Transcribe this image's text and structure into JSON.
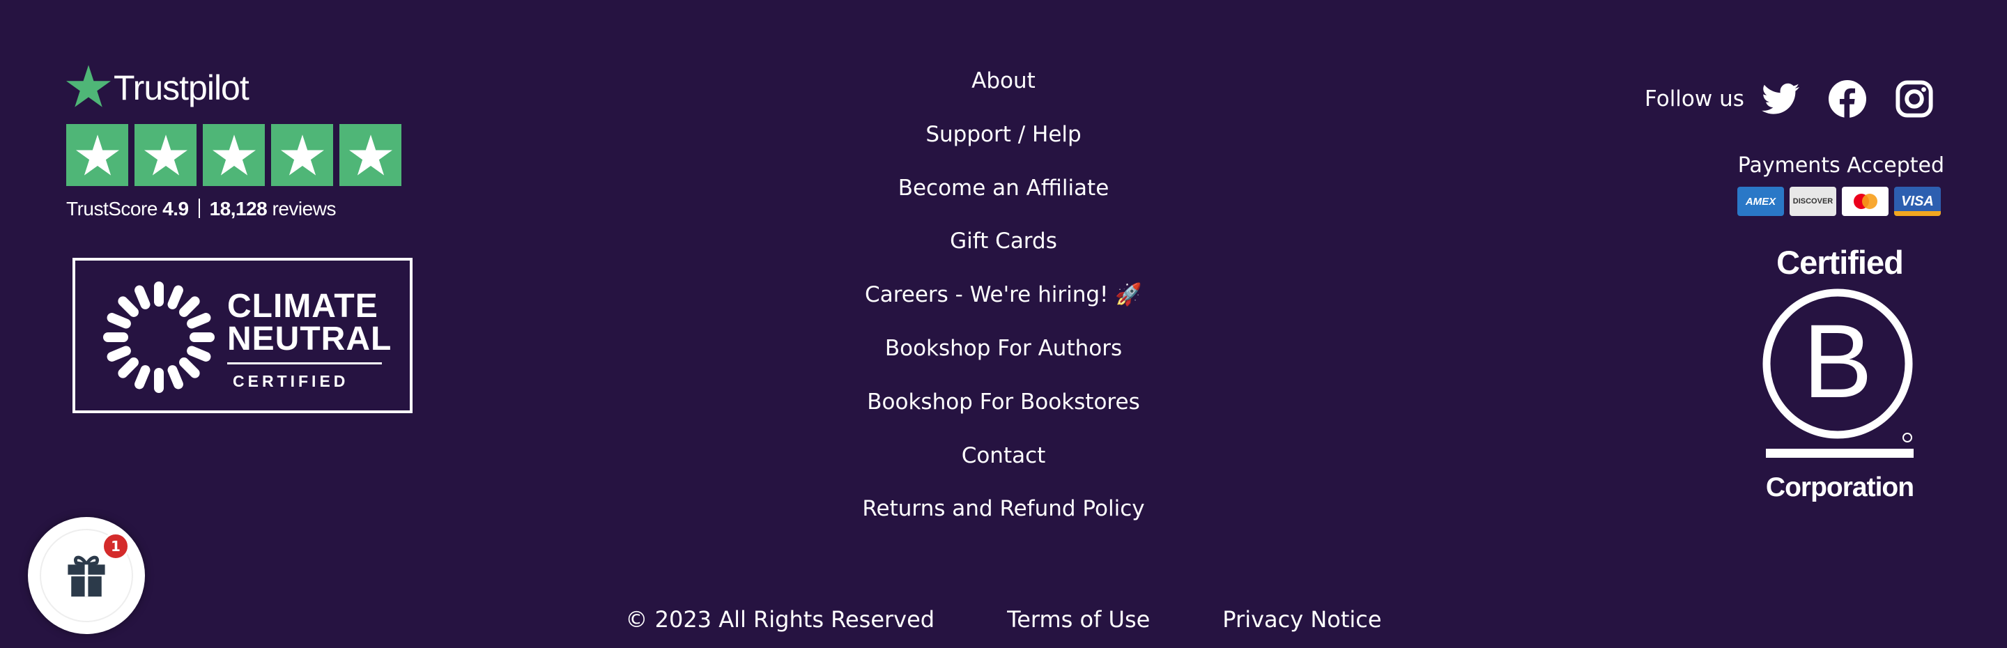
{
  "trustpilot": {
    "brand": "Trustpilot",
    "score_label": "TrustScore",
    "score_value": "4.9",
    "reviews_count": "18,128",
    "reviews_label": "reviews",
    "rating_stars": 5
  },
  "climate_badge": {
    "line1": "CLIMATE",
    "line2": "NEUTRAL",
    "line3": "CERTIFIED"
  },
  "footer_links": [
    "About",
    "Support / Help",
    "Become an Affiliate",
    "Gift Cards",
    "Careers - We're hiring! 🚀",
    "Bookshop For Authors",
    "Bookshop For Bookstores",
    "Contact",
    "Returns and Refund Policy"
  ],
  "social": {
    "label": "Follow us",
    "icons": [
      "twitter-icon",
      "facebook-icon",
      "instagram-icon"
    ]
  },
  "payments": {
    "label": "Payments Accepted",
    "cards": [
      "AMEX",
      "DISCOVER",
      "mastercard",
      "VISA"
    ]
  },
  "bcorp": {
    "top": "Certified",
    "bottom": "Corporation"
  },
  "bottom_bar": {
    "copyright": "© 2023 All Rights Reserved",
    "terms": "Terms of Use",
    "privacy": "Privacy Notice"
  },
  "gift_widget": {
    "badge_count": "1"
  },
  "colors": {
    "background": "#261341",
    "trustpilot_green": "#4fb677",
    "badge_red": "#d42b2b"
  }
}
